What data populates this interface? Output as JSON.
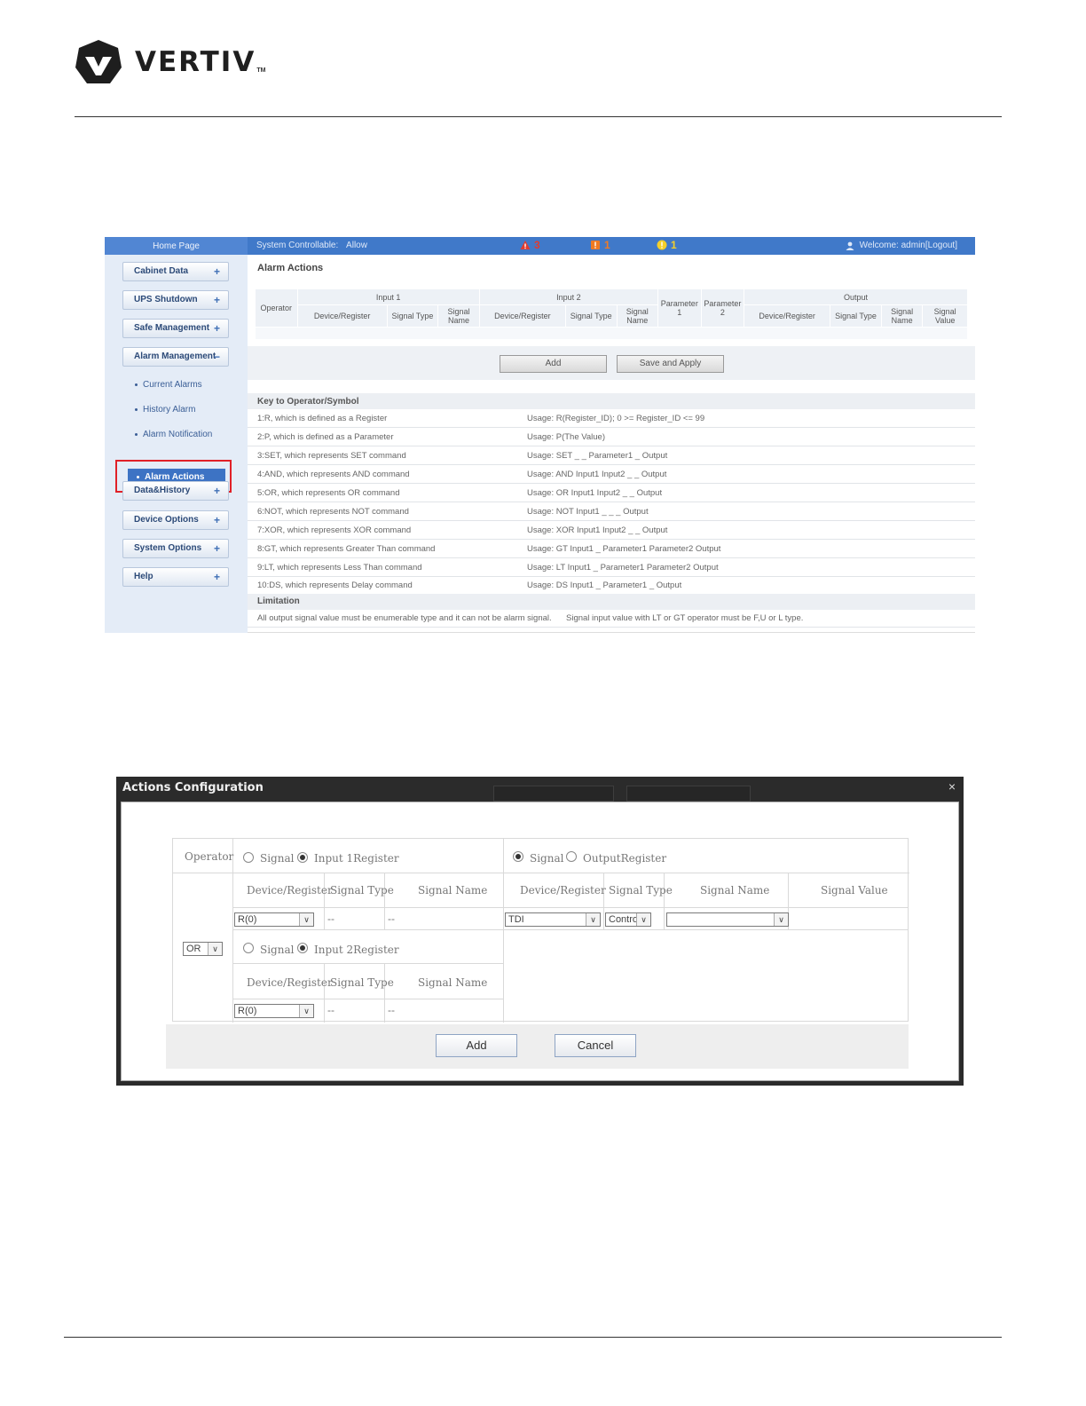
{
  "brand": {
    "name": "VERTIV",
    "tm": "TM"
  },
  "screenshot1": {
    "topbar": {
      "home_tab": "Home Page",
      "system_controllable_label": "System Controllable:",
      "system_controllable_value": "Allow",
      "critical_count": "3",
      "major_count": "1",
      "observation_count": "1",
      "welcome": "Welcome: admin[Logout]"
    },
    "sidebar": {
      "cabinet_data": "Cabinet Data",
      "ups_shutdown": "UPS Shutdown",
      "safe_management": "Safe Management",
      "alarm_management": "Alarm Management",
      "current_alarms": "Current Alarms",
      "history_alarm": "History Alarm",
      "alarm_notification": "Alarm Notification",
      "alarm_actions": "Alarm Actions",
      "data_history": "Data&History",
      "device_options": "Device Options",
      "system_options": "System Options",
      "help": "Help",
      "plus": "+",
      "minus": "−"
    },
    "page_title": "Alarm Actions",
    "table_headers": {
      "operator": "Operator",
      "input1": "Input 1",
      "input2": "Input 2",
      "parameter1": "Parameter 1",
      "parameter2": "Parameter 2",
      "output": "Output",
      "device_register": "Device/Register",
      "signal_type": "Signal Type",
      "signal_name": "Signal Name",
      "signal_value": "Signal Value"
    },
    "buttons": {
      "add": "Add",
      "save_apply": "Save and Apply"
    },
    "key_title": "Key to Operator/Symbol",
    "key_rows": [
      {
        "def": "1:R, which is defined as a Register",
        "usage": "Usage: R(Register_ID); 0 >= Register_ID <= 99"
      },
      {
        "def": "2:P, which is defined as a Parameter",
        "usage": "Usage: P(The Value)"
      },
      {
        "def": "3:SET, which represents SET command",
        "usage": "Usage: SET _ _ Parameter1 _ Output"
      },
      {
        "def": "4:AND, which represents AND command",
        "usage": "Usage: AND Input1 Input2 _ _ Output"
      },
      {
        "def": "5:OR, which represents OR command",
        "usage": "Usage: OR Input1 Input2 _ _ Output"
      },
      {
        "def": "6:NOT, which represents NOT command",
        "usage": "Usage: NOT Input1 _ _ _ Output"
      },
      {
        "def": "7:XOR, which represents XOR command",
        "usage": "Usage: XOR Input1 Input2 _ _ Output"
      },
      {
        "def": "8:GT, which represents Greater Than command",
        "usage": "Usage: GT Input1 _ Parameter1 Parameter2 Output"
      },
      {
        "def": "9:LT, which represents Less Than command",
        "usage": "Usage: LT Input1 _ Parameter1 Parameter2 Output"
      },
      {
        "def": "10:DS, which represents Delay command",
        "usage": "Usage: DS Input1 _ Parameter1 _ Output"
      }
    ],
    "limitation_title": "Limitation",
    "limitation_1": "All output signal value must be enumerable type and it can not be alarm signal.",
    "limitation_2": "Signal input value with LT or GT operator must be F,U or L type."
  },
  "screenshot2": {
    "title": "Actions Configuration",
    "close": "×",
    "operator_label": "Operator",
    "signal": "Signal",
    "input1_register": "Input 1Register",
    "input2_register": "Input 2Register",
    "output_register": "OutputRegister",
    "device_register": "Device/Register",
    "signal_type": "Signal Type",
    "signal_name": "Signal Name",
    "signal_value": "Signal Value",
    "operator_value": "OR",
    "input1_device_value": "R(0)",
    "input2_device_value": "R(0)",
    "output_device_value": "TDI",
    "output_type_value": "Control",
    "dash": "--",
    "arrow": "∨",
    "add": "Add",
    "cancel": "Cancel"
  }
}
